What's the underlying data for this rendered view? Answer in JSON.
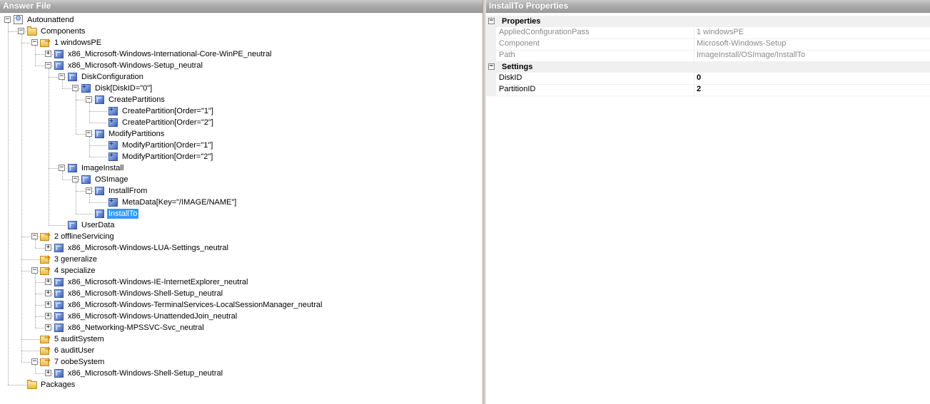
{
  "left_pane": {
    "title": "Answer File",
    "tree": [
      {
        "id": "autounattend",
        "label": "Autounattend",
        "icon": "answer-file-icon",
        "indent": 0,
        "expander": "-"
      },
      {
        "id": "components",
        "label": "Components",
        "icon": "folder-icon",
        "indent": 1,
        "expander": "-"
      },
      {
        "id": "windowspe",
        "label": "1 windowsPE",
        "icon": "config-pass-icon",
        "indent": 2,
        "expander": "-"
      },
      {
        "id": "intl-core-winpe",
        "label": "x86_Microsoft-Windows-International-Core-WinPE_neutral",
        "icon": "component-icon",
        "indent": 3,
        "expander": "+"
      },
      {
        "id": "setup-neutral",
        "label": "x86_Microsoft-Windows-Setup_neutral",
        "icon": "component-icon",
        "indent": 3,
        "expander": "-"
      },
      {
        "id": "diskconfiguration",
        "label": "DiskConfiguration",
        "icon": "component-icon",
        "indent": 4,
        "expander": "-"
      },
      {
        "id": "disk0",
        "label": "Disk[DiskID=\"0\"]",
        "icon": "list-item-icon",
        "indent": 5,
        "expander": "-"
      },
      {
        "id": "createpartitions",
        "label": "CreatePartitions",
        "icon": "component-icon",
        "indent": 6,
        "expander": "-"
      },
      {
        "id": "createpartition1",
        "label": "CreatePartition[Order=\"1\"]",
        "icon": "list-item-icon",
        "indent": 7,
        "expander": ""
      },
      {
        "id": "createpartition2",
        "label": "CreatePartition[Order=\"2\"]",
        "icon": "list-item-icon",
        "indent": 7,
        "expander": ""
      },
      {
        "id": "modifypartitions",
        "label": "ModifyPartitions",
        "icon": "component-icon",
        "indent": 6,
        "expander": "-"
      },
      {
        "id": "modifypartition1",
        "label": "ModifyPartition[Order=\"1\"]",
        "icon": "list-item-icon",
        "indent": 7,
        "expander": ""
      },
      {
        "id": "modifypartition2",
        "label": "ModifyPartition[Order=\"2\"]",
        "icon": "list-item-icon",
        "indent": 7,
        "expander": ""
      },
      {
        "id": "imageinstall",
        "label": "ImageInstall",
        "icon": "component-icon",
        "indent": 4,
        "expander": "-"
      },
      {
        "id": "osimage",
        "label": "OSImage",
        "icon": "component-icon",
        "indent": 5,
        "expander": "-"
      },
      {
        "id": "installfrom",
        "label": "InstallFrom",
        "icon": "component-icon",
        "indent": 6,
        "expander": "-"
      },
      {
        "id": "metadata",
        "label": "MetaData[Key=\"/IMAGE/NAME\"]",
        "icon": "list-item-icon",
        "indent": 7,
        "expander": ""
      },
      {
        "id": "installto",
        "label": "InstallTo",
        "icon": "component-icon",
        "indent": 6,
        "expander": "",
        "selected": true
      },
      {
        "id": "userdata",
        "label": "UserData",
        "icon": "component-icon",
        "indent": 4,
        "expander": ""
      },
      {
        "id": "offlineservicing",
        "label": "2 offlineServicing",
        "icon": "config-pass-icon",
        "indent": 2,
        "expander": "-"
      },
      {
        "id": "lua-settings",
        "label": "x86_Microsoft-Windows-LUA-Settings_neutral",
        "icon": "component-icon",
        "indent": 3,
        "expander": "+"
      },
      {
        "id": "generalize",
        "label": "3 generalize",
        "icon": "config-pass-icon",
        "indent": 2,
        "expander": ""
      },
      {
        "id": "specialize",
        "label": "4 specialize",
        "icon": "config-pass-icon",
        "indent": 2,
        "expander": "-"
      },
      {
        "id": "ie",
        "label": "x86_Microsoft-Windows-IE-InternetExplorer_neutral",
        "icon": "component-icon",
        "indent": 3,
        "expander": "+"
      },
      {
        "id": "shell-setup-spec",
        "label": "x86_Microsoft-Windows-Shell-Setup_neutral",
        "icon": "component-icon",
        "indent": 3,
        "expander": "+"
      },
      {
        "id": "terminal-services",
        "label": "x86_Microsoft-Windows-TerminalServices-LocalSessionManager_neutral",
        "icon": "component-icon",
        "indent": 3,
        "expander": "+"
      },
      {
        "id": "unattendedjoin",
        "label": "x86_Microsoft-Windows-UnattendedJoin_neutral",
        "icon": "component-icon",
        "indent": 3,
        "expander": "+"
      },
      {
        "id": "mpssvc",
        "label": "x86_Networking-MPSSVC-Svc_neutral",
        "icon": "component-icon",
        "indent": 3,
        "expander": "+"
      },
      {
        "id": "auditsystem",
        "label": "5 auditSystem",
        "icon": "config-pass-icon",
        "indent": 2,
        "expander": ""
      },
      {
        "id": "audituser",
        "label": "6 auditUser",
        "icon": "config-pass-icon",
        "indent": 2,
        "expander": ""
      },
      {
        "id": "oobesystem",
        "label": "7 oobeSystem",
        "icon": "config-pass-icon",
        "indent": 2,
        "expander": "-"
      },
      {
        "id": "shell-setup-oobe",
        "label": "x86_Microsoft-Windows-Shell-Setup_neutral",
        "icon": "component-icon",
        "indent": 3,
        "expander": "+"
      },
      {
        "id": "packages",
        "label": "Packages",
        "icon": "folder-icon",
        "indent": 1,
        "expander": ""
      }
    ]
  },
  "right_pane": {
    "title": "InstallTo Properties",
    "categories": [
      {
        "name": "Properties",
        "rows": [
          {
            "name": "AppliedConfigurationPass",
            "value": "1 windowsPE",
            "readonly": true
          },
          {
            "name": "Component",
            "value": "Microsoft-Windows-Setup",
            "readonly": true
          },
          {
            "name": "Path",
            "value": "ImageInstall/OSImage/InstallTo",
            "readonly": true
          }
        ]
      },
      {
        "name": "Settings",
        "rows": [
          {
            "name": "DiskID",
            "value": "0",
            "readonly": false
          },
          {
            "name": "PartitionID",
            "value": "2",
            "readonly": false
          }
        ]
      }
    ]
  }
}
